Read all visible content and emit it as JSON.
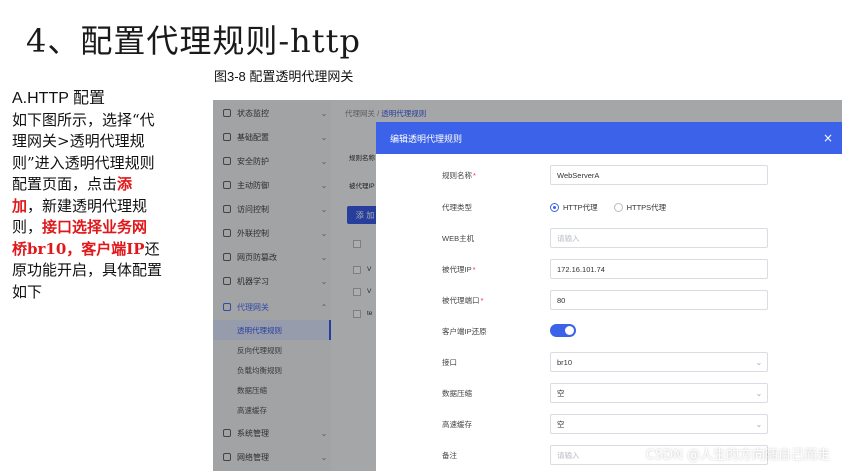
{
  "slide": {
    "title": "4、配置代理规则-http",
    "caption": "图3-8  配置透明代理网关",
    "text": {
      "heading": "A.HTTP 配置",
      "p1": "如下图所示，选择“代理网关>透明代理规则”进入透明代理规则配置页面，点击",
      "add": "添加",
      "p2": "，新建透明代理规则，",
      "bold1": "接口选择业务网桥br10，客户端IP",
      "p3": "还原功能开启，具体配置如下"
    }
  },
  "sidebar": {
    "items": [
      {
        "label": "状态监控",
        "arrow": "⌄"
      },
      {
        "label": "基础配置",
        "arrow": "⌄"
      },
      {
        "label": "安全防护",
        "arrow": "⌄"
      },
      {
        "label": "主动防御",
        "arrow": "⌄"
      },
      {
        "label": "访问控制",
        "arrow": "⌄"
      },
      {
        "label": "外联控制",
        "arrow": "⌄"
      },
      {
        "label": "网页防篡改",
        "arrow": "⌄"
      },
      {
        "label": "机器学习",
        "arrow": "⌄"
      },
      {
        "label": "代理网关",
        "arrow": "⌃"
      }
    ],
    "sub_items": [
      {
        "label": "透明代理规则"
      },
      {
        "label": "反向代理规则"
      },
      {
        "label": "负载均衡规则"
      },
      {
        "label": "数据压缩"
      },
      {
        "label": "高速缓存"
      }
    ],
    "bottom_items": [
      {
        "label": "系统管理",
        "arrow": "⌄"
      },
      {
        "label": "网络管理",
        "arrow": "⌄"
      }
    ]
  },
  "content": {
    "breadcrumb_parent": "代理网关",
    "breadcrumb_sep": "/",
    "breadcrumb_current": "透明代理规则",
    "bg_label1": "规则名称",
    "bg_label2": "被代理IP",
    "add_button": "添 加",
    "row_v1": "V",
    "row_v2": "V",
    "row_t": "te"
  },
  "modal": {
    "title": "编辑透明代理规则",
    "close": "×",
    "fields": {
      "rule_name": {
        "label": "规则名称",
        "required": "*",
        "value": "WebServerA"
      },
      "proxy_type": {
        "label": "代理类型",
        "options": [
          "HTTP代理",
          "HTTPS代理"
        ],
        "selected": "HTTP代理"
      },
      "web_host": {
        "label": "WEB主机",
        "placeholder": "请输入"
      },
      "proxied_ip": {
        "label": "被代理IP",
        "required": "*",
        "value": "172.16.101.74"
      },
      "proxied_port": {
        "label": "被代理端口",
        "required": "*",
        "value": "80"
      },
      "client_ip_restore": {
        "label": "客户端IP还原",
        "enabled": true
      },
      "interface": {
        "label": "接口",
        "value": "br10"
      },
      "data_compression": {
        "label": "数据压缩",
        "value": "空"
      },
      "cache": {
        "label": "高速缓存",
        "value": "空"
      },
      "note": {
        "label": "备注",
        "placeholder": "请输入"
      }
    }
  },
  "watermark": "CSDN @人生的方向随自己而走",
  "colors": {
    "accent": "#3b62e8",
    "highlight_red": "#e0181b"
  }
}
